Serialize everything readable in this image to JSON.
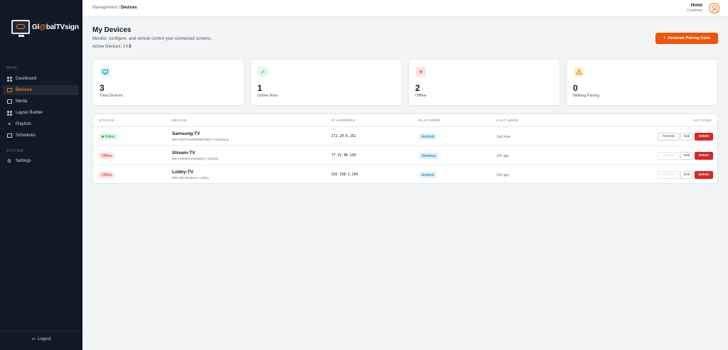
{
  "app": {
    "logo_prefix": "Gl",
    "logo_o": "@",
    "logo_mid": "bal",
    "logo_suffix": "TVsign"
  },
  "sidebar": {
    "section_main": "MAIN",
    "section_system": "SYSTEM",
    "items": [
      {
        "label": "Dashboard",
        "icon": "dashboard-icon"
      },
      {
        "label": "Devices",
        "icon": "monitor-icon",
        "active": true
      },
      {
        "label": "Media",
        "icon": "image-icon"
      },
      {
        "label": "Layout Builder",
        "icon": "grid-icon"
      },
      {
        "label": "Playlists",
        "icon": "list-icon"
      },
      {
        "label": "Schedules",
        "icon": "calendar-icon"
      }
    ],
    "settings": "Settings",
    "logout": "Logout"
  },
  "topbar": {
    "breadcrumb_root": "Management",
    "breadcrumb_sep": "/",
    "breadcrumb_current": "Devices",
    "user_name": "Hotel",
    "user_role": "Customer"
  },
  "header": {
    "title": "My Devices",
    "subtitle": "Monitor, configure, and remote control your connected screens.",
    "active_label": "Active Devices:",
    "active_count": "3",
    "active_sep": "/",
    "active_total": "3",
    "generate_button": "Generate Pairing Code",
    "generate_icon": "+"
  },
  "stats": [
    {
      "value": "3",
      "label": "Total Devices",
      "icon": "monitor-icon",
      "color": "#0284c7",
      "bg": "#e0f2fe"
    },
    {
      "value": "1",
      "label": "Online Now",
      "icon": "check-icon",
      "color": "#16a34a",
      "bg": "#dcfce7"
    },
    {
      "value": "2",
      "label": "Offline",
      "icon": "x-icon",
      "color": "#dc2626",
      "bg": "#fee2e2"
    },
    {
      "value": "0",
      "label": "Waiting Pairing",
      "icon": "warning-icon",
      "color": "#d97706",
      "bg": "#fef3c7"
    }
  ],
  "table": {
    "headers": {
      "status": "STATUS",
      "device": "DEVICE",
      "ip": "IP ADDRESS",
      "platform": "PLATFORM",
      "last_seen": "LAST SEEN",
      "actions": "ACTIONS"
    },
    "rows": [
      {
        "status": "Online",
        "name": "Samsung TV",
        "meta": "DEV-WSTYXZW8GBVDDV / Samsung",
        "ip": "172.20.6.252",
        "platform": "Android",
        "last_seen": "Just now",
        "remote": "Remote",
        "edit": "Edit",
        "delete": "Delete"
      },
      {
        "status": "Offline",
        "name": "Stream-TV",
        "meta": "DEV-MS6R0G8S6Q0A / Stream",
        "ip": "77.31.96.130",
        "platform": "Windows",
        "last_seen": "16h ago",
        "remote": "Remote",
        "edit": "Edit",
        "delete": "Delete"
      },
      {
        "status": "Offline",
        "name": "Lobby-TV",
        "meta": "DEV-NKYNH6AS / Lobby",
        "ip": "192.168.1.104",
        "platform": "Android",
        "last_seen": "19h ago",
        "remote": "Remote",
        "edit": "Edit",
        "delete": "Delete"
      }
    ]
  },
  "colors": {
    "accent": "#f97316",
    "sidebar_bg": "#111827",
    "danger": "#dc2626",
    "success": "#16a34a"
  }
}
